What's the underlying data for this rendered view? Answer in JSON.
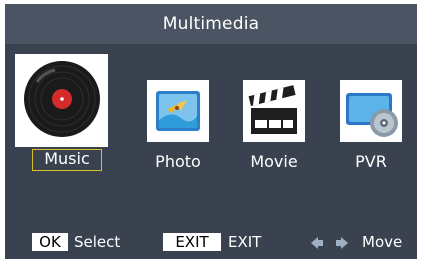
{
  "header": {
    "title": "Multimedia"
  },
  "menu": {
    "items": [
      {
        "label": "Music",
        "icon": "music-vinyl-icon",
        "selected": true
      },
      {
        "label": "Photo",
        "icon": "photo-icon",
        "selected": false
      },
      {
        "label": "Movie",
        "icon": "movie-clapperboard-icon",
        "selected": false
      },
      {
        "label": "PVR",
        "icon": "pvr-disc-icon",
        "selected": false
      }
    ]
  },
  "footer": {
    "ok_key": "OK",
    "ok_action": "Select",
    "exit_key": "EXIT",
    "exit_action": "EXIT",
    "move_action": "Move"
  },
  "colors": {
    "background": "#3a4250",
    "title_bar": "#4b5462",
    "selection_border": "#d7c22a",
    "text": "#ffffff"
  }
}
